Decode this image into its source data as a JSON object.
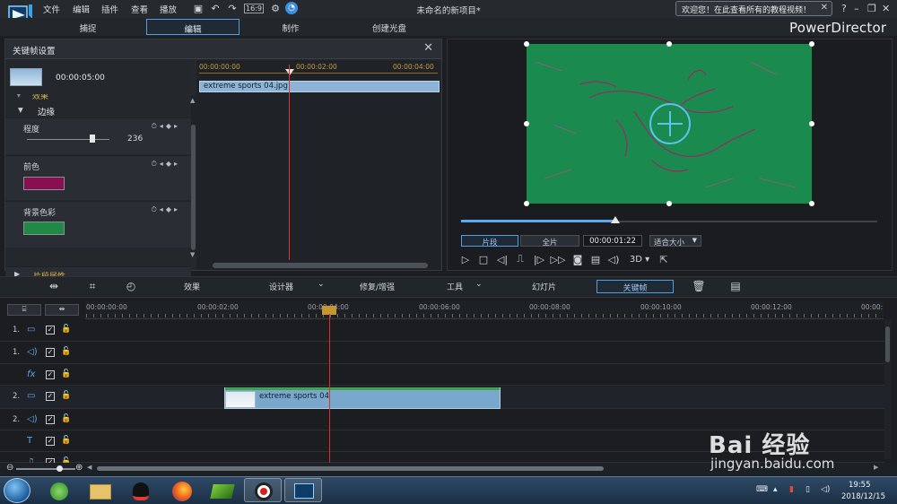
{
  "menu": {
    "items": [
      "文件",
      "编辑",
      "插件",
      "查看",
      "播放"
    ],
    "project_title": "未命名的新项目*",
    "welcome_banner": "欢迎您！在此查看所有的教程视频！"
  },
  "modes": {
    "tabs": [
      "捕捉",
      "编辑",
      "制作",
      "创建光盘"
    ],
    "active": "编辑",
    "brand": "PowerDirector"
  },
  "keyframe_panel": {
    "title": "关键帧设置",
    "clip_duration": "00:00:05:00",
    "ruler": [
      "00:00:00:00",
      "00:00:02:00",
      "00:00:04:00"
    ],
    "clip_name": "extreme sports 04.jpg",
    "section_effects": "效果",
    "section_edge": "边缘",
    "degree_label": "程度",
    "degree_value": "236",
    "degree_level": 0.72,
    "fg_label": "前色",
    "fg_color": "#8a0f52",
    "bg_label": "背景色彩",
    "bg_color": "#1f8a45",
    "clip_props": "片段属性"
  },
  "preview": {
    "segment_clip": "片段",
    "segment_full": "全片",
    "timecode": "00:00:01:22",
    "fit": "适合大小",
    "mode_3d": "3D",
    "progress": 0.37
  },
  "toolbar": {
    "effects": "效果",
    "designer": "设计器",
    "fix_enhance": "修复/增强",
    "tools": "工具",
    "slideshow": "幻灯片",
    "keyframe": "关键帧"
  },
  "timeline": {
    "ruler": [
      "00:00:00:00",
      "00:00:02:00",
      "00:00:04:00",
      "00:00:06:00",
      "00:00:08:00",
      "00:00:10:00",
      "00:00:12:00",
      "00:00:"
    ],
    "tracks": [
      {
        "num": "1.",
        "kind": "video"
      },
      {
        "num": "1.",
        "kind": "audio"
      },
      {
        "num": "",
        "kind": "fx"
      },
      {
        "num": "2.",
        "kind": "video"
      },
      {
        "num": "2.",
        "kind": "audio"
      },
      {
        "num": "",
        "kind": "title"
      },
      {
        "num": "",
        "kind": "voice"
      }
    ],
    "clip_label": "extreme sports 04"
  },
  "taskbar": {
    "time": "19:55",
    "date": "2018/12/15"
  },
  "watermark": {
    "brand": "Bai 经验",
    "url": "jingyan.baidu.com"
  },
  "colors": {
    "accent": "#4f9fe0",
    "playhead": "#e0362f",
    "video_bg": "#1a8a4e",
    "clip_fill": "#7aa7cc"
  }
}
